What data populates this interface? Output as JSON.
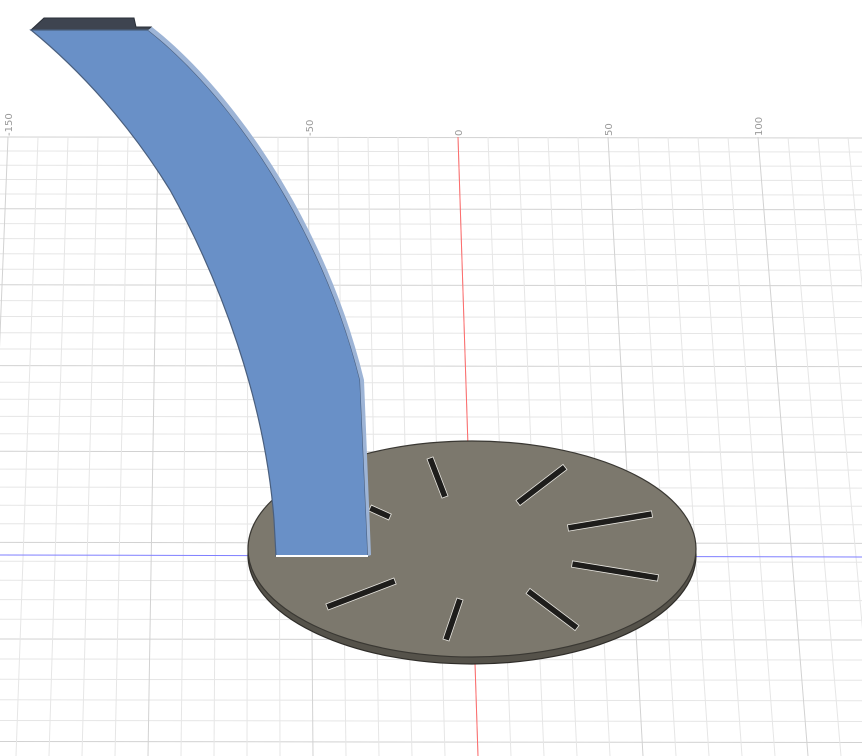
{
  "viewport": {
    "background": "#ffffff",
    "grid_minor_color": "#e6e6e6",
    "grid_major_color": "#d2d2d2",
    "axis_x_color": "#7f7fff",
    "axis_y_color": "#ff6b6b",
    "ruler_labels": [
      "-150",
      "-50",
      "0",
      "50",
      "100"
    ]
  },
  "bodies": {
    "arc_bracket": {
      "name": "arc-bracket",
      "color": "#6990c7",
      "edge_color": "#4a5f7e"
    },
    "disc_plate": {
      "name": "disc-plate",
      "color": "#7c786d",
      "edge_color": "#3a3833",
      "slot_count": 9
    }
  }
}
